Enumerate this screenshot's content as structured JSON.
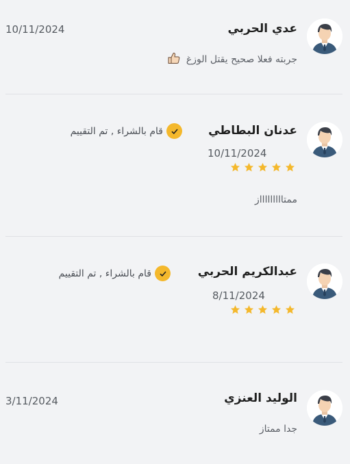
{
  "reviews": [
    {
      "name": "عدي الحربي",
      "date": "10/11/2024",
      "comment": "جربته فعلا صحيح يقتل الوزغ",
      "emoji": "thumbs-up-icon"
    },
    {
      "name": "عدنان البطاطي",
      "date": "10/11/2024",
      "verified_text": "قام بالشراء , تم التقييم",
      "stars": 5,
      "comment": "ممتاااااااااز"
    },
    {
      "name": "عبدالكريم الحربي",
      "date": "8/11/2024",
      "verified_text": "قام بالشراء , تم التقييم",
      "stars": 5,
      "comment": ""
    },
    {
      "name": "الوليد العنزي",
      "date": "3/11/2024",
      "comment": "جدا ممتاز"
    }
  ],
  "colors": {
    "background": "#f2f3f5",
    "star": "#f4b82c",
    "verified_badge": "#f4b82c",
    "avatar_shirt": "#3a5a7a",
    "divider": "#dfe1e5"
  }
}
